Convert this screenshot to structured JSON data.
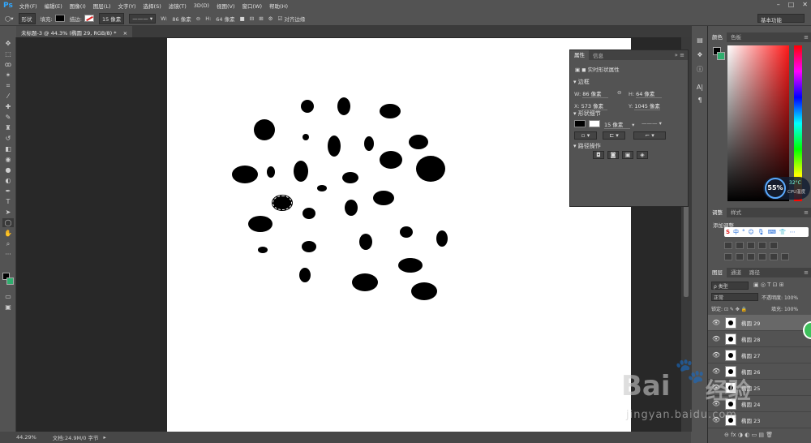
{
  "app": {
    "logo": "Ps"
  },
  "menubar": {
    "items": [
      "文件(F)",
      "编辑(E)",
      "图像(I)",
      "图层(L)",
      "文字(Y)",
      "选择(S)",
      "滤镜(T)",
      "3D(D)",
      "视图(V)",
      "窗口(W)",
      "帮助(H)"
    ]
  },
  "options": {
    "mode": "形状",
    "fill_label": "填充:",
    "stroke_label": "描边:",
    "stroke_width": "15 像素",
    "w_label": "W:",
    "w_value": "86 像素",
    "link_symbol": "⊖",
    "h_label": "H:",
    "h_value": "64 像素",
    "align_edges": "对齐边缘",
    "workspace": "基本功能"
  },
  "document": {
    "tab_title": "未标题-3 @ 44.3% (椭圆 29, RGB/8) *",
    "zoom": "44.29%",
    "doc_info": "文档:24.9M/0 字节"
  },
  "properties_panel": {
    "tabs": [
      "属性",
      "信息"
    ],
    "title": "实时形状属性",
    "bounds_label": "边框",
    "w_label": "W:",
    "w_value": "86 像素",
    "h_label": "H:",
    "h_value": "64 像素",
    "x_label": "X:",
    "x_value": "573 像素",
    "y_label": "Y:",
    "y_value": "1045 像素",
    "shape_details_label": "形状细节",
    "stroke_width": "15 像素",
    "path_ops_label": "路径操作"
  },
  "color_panel": {
    "tabs": [
      "颜色",
      "色板"
    ],
    "foreground": "#000000",
    "background": "#2fae6e"
  },
  "cpu_widget": {
    "percent": "55%",
    "temp": "32°C",
    "label": "CPU温度"
  },
  "adjust_panel": {
    "tabs": [
      "调整",
      "样式"
    ],
    "add_label": "添加调整",
    "ime_items": [
      "中",
      "°"
    ]
  },
  "layers_panel": {
    "tabs": [
      "图层",
      "通道",
      "路径"
    ],
    "kind_filter": "ρ 类型",
    "blend_mode": "正常",
    "opacity_label": "不透明度:",
    "opacity_value": "100%",
    "lock_label": "锁定:",
    "fill_label": "填充:",
    "fill_value": "100%",
    "layers": [
      "椭圆 29",
      "椭圆 28",
      "椭圆 27",
      "椭圆 26",
      "椭圆 25",
      "椭圆 24",
      "椭圆 23"
    ]
  },
  "watermark": {
    "brand": "Bai",
    "brand2": "经验",
    "url": "jingyan.baidu.com"
  }
}
